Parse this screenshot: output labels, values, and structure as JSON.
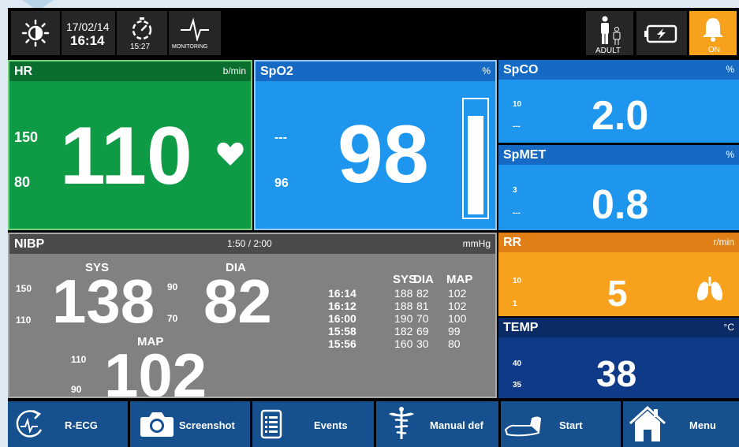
{
  "topbar": {
    "date": "17/02/14",
    "time": "16:14",
    "timer": "15:27",
    "mode": "MONITORING",
    "patient_type": "ADULT",
    "alarm_status": "ON",
    "icons": [
      "brightness-icon",
      "stopwatch-icon",
      "heartbeat-icon",
      "adult-patient-icon",
      "battery-charging-icon",
      "bell-icon"
    ]
  },
  "hr": {
    "label": "HR",
    "unit": "b/min",
    "value": "110",
    "high_limit": "150",
    "low_limit": "80",
    "color": "#0f9b45"
  },
  "spo2": {
    "label": "SpO2",
    "unit": "%",
    "value": "98",
    "high_limit": "---",
    "low_limit": "96",
    "perfusion_fill": 0.88,
    "color": "#1e96ee"
  },
  "spco": {
    "label": "SpCO",
    "unit": "%",
    "value": "2.0",
    "high_limit": "10",
    "low_limit": "---"
  },
  "spmet": {
    "label": "SpMET",
    "unit": "%",
    "value": "0.8",
    "high_limit": "3",
    "low_limit": "---"
  },
  "nibp": {
    "label": "NIBP",
    "interval": "1:50 / 2:00",
    "unit": "mmHg",
    "sys_label": "SYS",
    "dia_label": "DIA",
    "map_label": "MAP",
    "sys": "138",
    "dia": "82",
    "map": "102",
    "sys_high": "150",
    "sys_low": "110",
    "dia_high": "90",
    "dia_low": "70",
    "map_high": "110",
    "map_low": "90",
    "history_headers": [
      "SYS",
      "DIA",
      "MAP"
    ],
    "history": [
      {
        "time": "16:14",
        "sys": "188",
        "dia": "82",
        "map": "102"
      },
      {
        "time": "16:12",
        "sys": "188",
        "dia": "81",
        "map": "102"
      },
      {
        "time": "16:00",
        "sys": "190",
        "dia": "70",
        "map": "100"
      },
      {
        "time": "15:58",
        "sys": "182",
        "dia": "69",
        "map": "99"
      },
      {
        "time": "15:56",
        "sys": "160",
        "dia": "30",
        "map": "80"
      }
    ],
    "color": "#818181"
  },
  "rr": {
    "label": "RR",
    "unit": "r/min",
    "value": "5",
    "high_limit": "10",
    "low_limit": "1",
    "color": "#f7a11c"
  },
  "temp": {
    "label": "TEMP",
    "unit": "°C",
    "value": "38",
    "high_limit": "40",
    "low_limit": "35",
    "color": "#0f3a87"
  },
  "toolbar": {
    "r_ecg": "R-ECG",
    "screenshot": "Screenshot",
    "events": "Events",
    "manual_def": "Manual def",
    "start": "Start",
    "menu": "Menu",
    "color": "#16508f"
  }
}
